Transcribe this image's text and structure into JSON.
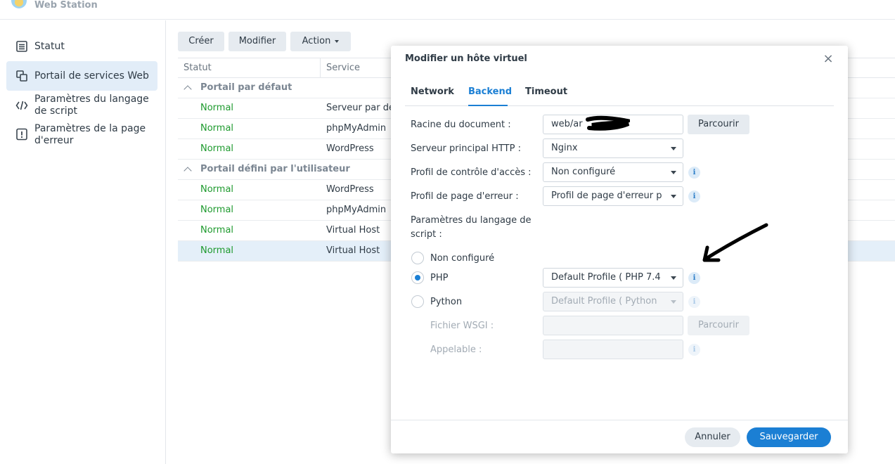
{
  "app": {
    "title": "Web Station"
  },
  "sidebar": {
    "items": [
      {
        "label": "Statut",
        "icon": "list-icon"
      },
      {
        "label": "Portail de services Web",
        "icon": "portal-icon"
      },
      {
        "label": "Paramètres du langage de script",
        "icon": "code-icon"
      },
      {
        "label": "Paramètres de la page d'erreur",
        "icon": "alert-icon"
      }
    ],
    "active_index": 1
  },
  "toolbar": {
    "create": "Créer",
    "edit": "Modifier",
    "action": "Action"
  },
  "table": {
    "columns": [
      "Statut",
      "Service"
    ],
    "groups": [
      {
        "label": "Portail par défaut",
        "rows": [
          {
            "status": "Normal",
            "service": "Serveur par dé"
          },
          {
            "status": "Normal",
            "service": "phpMyAdmin"
          },
          {
            "status": "Normal",
            "service": "WordPress"
          }
        ]
      },
      {
        "label": "Portail défini par l'utilisateur",
        "rows": [
          {
            "status": "Normal",
            "service": "WordPress"
          },
          {
            "status": "Normal",
            "service": "phpMyAdmin"
          },
          {
            "status": "Normal",
            "service": "Virtual Host"
          },
          {
            "status": "Normal",
            "service": "Virtual Host"
          }
        ]
      }
    ],
    "selected_row": "group2.row4"
  },
  "modal": {
    "title": "Modifier un hôte virtuel",
    "close": "×",
    "tabs": [
      "Network",
      "Backend",
      "Timeout"
    ],
    "active_tab": "Backend",
    "fields": {
      "doc_root_label": "Racine du document :",
      "doc_root_value": "web/ar",
      "browse": "Parcourir",
      "http_label": "Serveur principal HTTP :",
      "http_value": "Nginx",
      "access_label": "Profil de contrôle d'accès :",
      "access_value": "Non configuré",
      "error_label": "Profil de page d'erreur :",
      "error_value": "Profil de page d'erreur p",
      "script_label_1": "Paramètres du langage de",
      "script_label_2": "script :",
      "radio_none": "Non configuré",
      "radio_php": "PHP",
      "php_value": "Default Profile ( PHP 7.4",
      "radio_python": "Python",
      "python_value": "Default Profile ( Python",
      "wsgi_label": "Fichier WSGI :",
      "callable_label": "Appelable :",
      "info": "i"
    },
    "footer": {
      "cancel": "Annuler",
      "save": "Sauvegarder"
    }
  },
  "colors": {
    "accent": "#1b7fd4",
    "status_ok": "#1e9a2e",
    "selected_row": "#e4eff9"
  }
}
